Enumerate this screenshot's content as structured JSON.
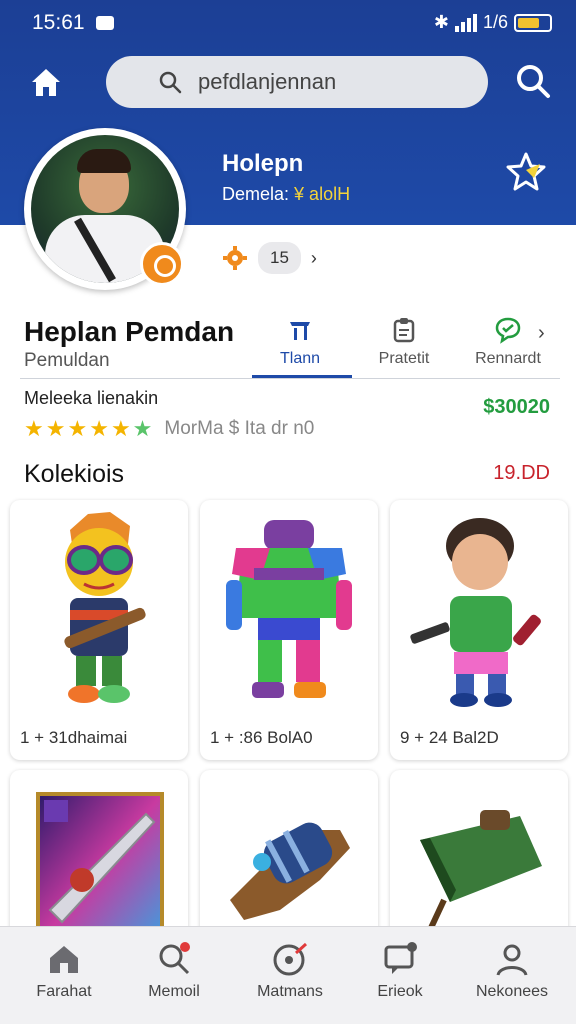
{
  "status": {
    "time": "15:61",
    "right_text": "1/6"
  },
  "search": {
    "value": "pefdlanjennan"
  },
  "profile": {
    "username": "Holepn",
    "sub_label": "Demela:",
    "sub_value": "\u0000A alolH",
    "level_value": "15",
    "name": "Heplan Pemdan",
    "subtitle": "Pemuldan"
  },
  "tabs": [
    {
      "label": "Tlann",
      "icon": "shop-icon"
    },
    {
      "label": "Pratetit",
      "icon": "clipboard-icon"
    },
    {
      "label": "Rennardt",
      "icon": "chat-icon"
    }
  ],
  "seller": {
    "title": "Meleeka lienakin",
    "stars": 5,
    "note": "MorMa $ Ita dr n0",
    "price": "$30020"
  },
  "collection": {
    "title": "Kolekiois",
    "count": "19.DD",
    "items": [
      {
        "caption": "1 + 31dhaimai",
        "icon": "goggles-figure-icon"
      },
      {
        "caption": "1 + :86 BolA0",
        "icon": "armor-figure-icon"
      },
      {
        "caption": "9 + 24 Bal2D",
        "icon": "soccer-figure-icon"
      },
      {
        "caption": "",
        "icon": "sword-card-icon"
      },
      {
        "caption": "",
        "icon": "gauntlet-icon"
      },
      {
        "caption": "",
        "icon": "satchel-icon"
      }
    ]
  },
  "nav": [
    {
      "label": "Farahat",
      "icon": "home-icon"
    },
    {
      "label": "Memoil",
      "icon": "search-notify-icon"
    },
    {
      "label": "Matmans",
      "icon": "target-icon"
    },
    {
      "label": "Erieok",
      "icon": "message-icon"
    },
    {
      "label": "Nekonees",
      "icon": "user-icon"
    }
  ],
  "colors": {
    "brand": "#1e4aa8",
    "price": "#239c3f",
    "count": "#c8232c",
    "accent": "#f08a1c"
  }
}
